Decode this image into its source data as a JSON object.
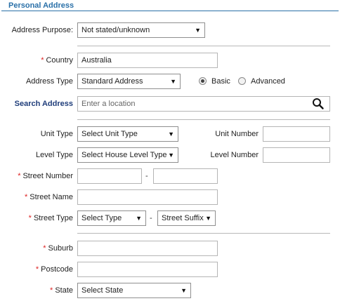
{
  "section": {
    "title": "Personal Address"
  },
  "purpose": {
    "label": "Address Purpose:",
    "value": "Not stated/unknown"
  },
  "country": {
    "required": "*",
    "label": "Country",
    "value": "Australia"
  },
  "address_type": {
    "label": "Address Type",
    "value": "Standard Address",
    "radio_basic": "Basic",
    "radio_advanced": "Advanced",
    "selected": "Basic"
  },
  "search": {
    "label": "Search Address",
    "placeholder": "Enter a location",
    "icon": "search-icon"
  },
  "unit_type": {
    "label": "Unit Type",
    "value": "Select Unit Type"
  },
  "unit_number": {
    "label": "Unit Number",
    "value": ""
  },
  "level_type": {
    "label": "Level Type",
    "value": "Select House Level Type"
  },
  "level_number": {
    "label": "Level Number",
    "value": ""
  },
  "street_number": {
    "required": "*",
    "label": "Street Number",
    "from": "",
    "separator": "-",
    "to": ""
  },
  "street_name": {
    "required": "*",
    "label": "Street Name",
    "value": ""
  },
  "street_type": {
    "required": "*",
    "label": "Street Type",
    "value": "Select Type",
    "separator": "-",
    "suffix": "Street Suffix"
  },
  "suburb": {
    "required": "*",
    "label": "Suburb",
    "value": ""
  },
  "postcode": {
    "required": "*",
    "label": "Postcode",
    "value": ""
  },
  "state": {
    "required": "*",
    "label": "State",
    "value": "Select State"
  },
  "dropdown_arrow": "▼"
}
